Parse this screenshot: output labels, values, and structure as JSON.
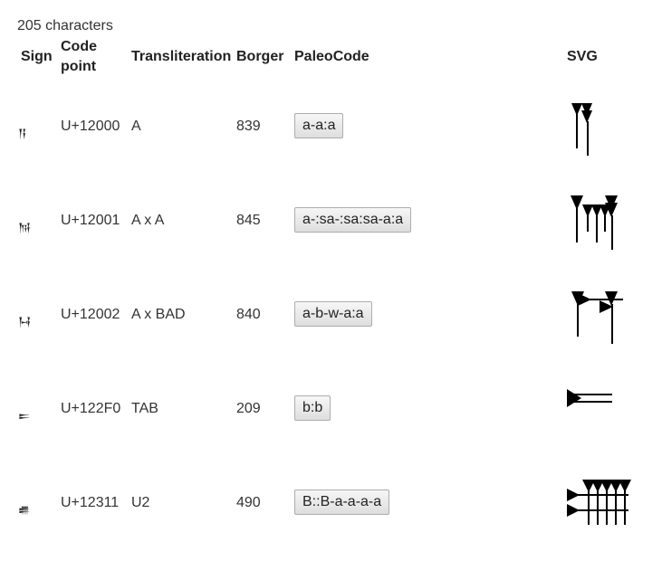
{
  "summary": "205 characters",
  "headers": {
    "sign": "Sign",
    "code_point_line1": "Code",
    "code_point_line2": "point",
    "transliteration": "Transliteration",
    "borger": "Borger",
    "paleocode": "PaleoCode",
    "svg": "SVG"
  },
  "rows": [
    {
      "sign": "𒀀",
      "code_point": "U+12000",
      "transliteration": "A",
      "borger": "839",
      "paleocode": "a-a:a"
    },
    {
      "sign": "𒀁",
      "code_point": "U+12001",
      "transliteration": "A x A",
      "borger": "845",
      "paleocode": "a-:sa-:sa:sa-a:a"
    },
    {
      "sign": "𒀂",
      "code_point": "U+12002",
      "transliteration": "A x BAD",
      "borger": "840",
      "paleocode": "a-b-w-a:a"
    },
    {
      "sign": "𒋰",
      "code_point": "U+122F0",
      "transliteration": "TAB",
      "borger": "209",
      "paleocode": "b:b"
    },
    {
      "sign": "𒌑",
      "code_point": "U+12311",
      "transliteration": "U2",
      "borger": "490",
      "paleocode": "B::B-a-a-a-a"
    }
  ],
  "icons": [
    "cuneiform-a-svg",
    "cuneiform-a-x-a-svg",
    "cuneiform-a-x-bad-svg",
    "cuneiform-tab-svg",
    "cuneiform-u2-svg"
  ]
}
